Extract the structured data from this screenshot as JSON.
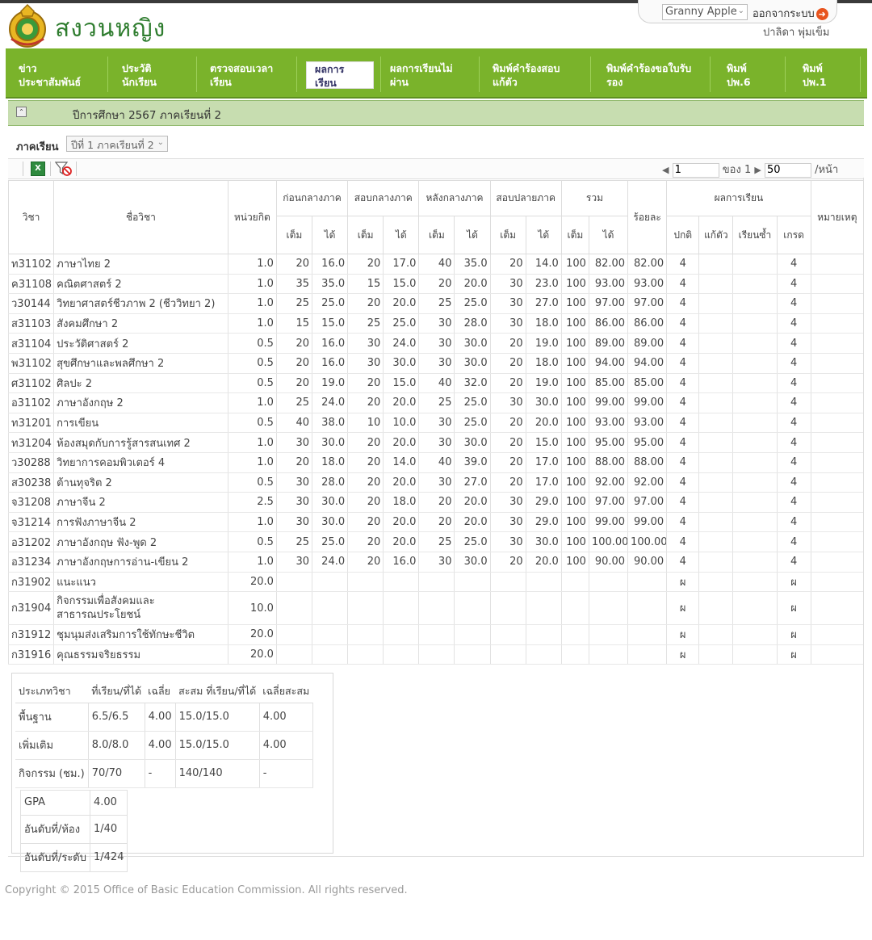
{
  "header": {
    "site_name": "สงวนหญิง",
    "user_select_value": "Granny Apple",
    "logout_label": "ออกจากระบบ",
    "username": "ปาลิดา  พุ่มเข็ม"
  },
  "nav": [
    {
      "line1": "ข่าว",
      "line2": "ประชาสัมพันธ์"
    },
    {
      "line1": "ประวัติ",
      "line2": "นักเรียน"
    },
    {
      "line1": "ตรวจสอบเวลา",
      "line2": "เรียน"
    },
    {
      "line1": "ผลการ",
      "line2": "เรียน"
    },
    {
      "line1": "ผลการเรียนไม่",
      "line2": "ผ่าน"
    },
    {
      "line1": "พิมพ์คำร้องสอบ",
      "line2": "แก้ตัว"
    },
    {
      "line1": "พิมพ์คำร้องขอใบรับ",
      "line2": "รอง"
    },
    {
      "line1": "พิมพ์",
      "line2": "ปพ.6"
    },
    {
      "line1": "พิมพ์",
      "line2": "ปพ.1"
    }
  ],
  "year_header": "ปีการศึกษา  2567  ภาคเรียนที่  2",
  "semester": {
    "label": "ภาคเรียน",
    "value": "ปีที่  1  ภาคเรียนที่  2"
  },
  "pager": {
    "page": "1",
    "of_label": "ของ",
    "total_pages": "1",
    "page_size": "50",
    "per_page_label": "/หน้า"
  },
  "table": {
    "headers": {
      "code": "วิชา",
      "name": "ชื่อวิชา",
      "credit": "หน่วยกิต",
      "before_mid": "ก่อนกลางภาค",
      "mid": "สอบกลางภาค",
      "after_mid": "หลังกลางภาค",
      "final": "สอบปลายภาค",
      "total": "รวม",
      "percent": "ร้อยละ",
      "results": "ผลการเรียน",
      "remarks": "หมายเหตุ",
      "full": "เต็ม",
      "got": "ได้",
      "normal": "ปกติ",
      "retest": "แก้ตัว",
      "repeat": "เรียนซ้ำ",
      "grade": "เกรด"
    },
    "rows": [
      {
        "code": "ท31102",
        "name": "ภาษาไทย  2",
        "credit": "1.0",
        "v": [
          "20",
          "16.0",
          "20",
          "17.0",
          "40",
          "35.0",
          "20",
          "14.0",
          "100",
          "82.00"
        ],
        "percent": "82.00",
        "normal": "4",
        "retest": "",
        "repeat": "",
        "grade": "4"
      },
      {
        "code": "ค31108",
        "name": "คณิตศาสตร์  2",
        "credit": "1.0",
        "v": [
          "35",
          "35.0",
          "15",
          "15.0",
          "20",
          "20.0",
          "30",
          "23.0",
          "100",
          "93.00"
        ],
        "percent": "93.00",
        "normal": "4",
        "retest": "",
        "repeat": "",
        "grade": "4"
      },
      {
        "code": "ว30144",
        "name": "วิทยาศาสตร์ชีวภาพ  2  (ชีววิทยา  2)",
        "credit": "1.0",
        "v": [
          "25",
          "25.0",
          "20",
          "20.0",
          "25",
          "25.0",
          "30",
          "27.0",
          "100",
          "97.00"
        ],
        "percent": "97.00",
        "normal": "4",
        "retest": "",
        "repeat": "",
        "grade": "4"
      },
      {
        "code": "ส31103",
        "name": "สังคมศึกษา  2",
        "credit": "1.0",
        "v": [
          "15",
          "15.0",
          "25",
          "25.0",
          "30",
          "28.0",
          "30",
          "18.0",
          "100",
          "86.00"
        ],
        "percent": "86.00",
        "normal": "4",
        "retest": "",
        "repeat": "",
        "grade": "4"
      },
      {
        "code": "ส31104",
        "name": "ประวัติศาสตร์  2",
        "credit": "0.5",
        "v": [
          "20",
          "16.0",
          "30",
          "24.0",
          "30",
          "30.0",
          "20",
          "19.0",
          "100",
          "89.00"
        ],
        "percent": "89.00",
        "normal": "4",
        "retest": "",
        "repeat": "",
        "grade": "4"
      },
      {
        "code": "พ31102",
        "name": "สุขศึกษาและพลศึกษา  2",
        "credit": "0.5",
        "v": [
          "20",
          "16.0",
          "30",
          "30.0",
          "30",
          "30.0",
          "20",
          "18.0",
          "100",
          "94.00"
        ],
        "percent": "94.00",
        "normal": "4",
        "retest": "",
        "repeat": "",
        "grade": "4"
      },
      {
        "code": "ศ31102",
        "name": "ศิลปะ  2",
        "credit": "0.5",
        "v": [
          "20",
          "19.0",
          "20",
          "15.0",
          "40",
          "32.0",
          "20",
          "19.0",
          "100",
          "85.00"
        ],
        "percent": "85.00",
        "normal": "4",
        "retest": "",
        "repeat": "",
        "grade": "4"
      },
      {
        "code": "อ31102",
        "name": "ภาษาอังกฤษ  2",
        "credit": "1.0",
        "v": [
          "25",
          "24.0",
          "20",
          "20.0",
          "25",
          "25.0",
          "30",
          "30.0",
          "100",
          "99.00"
        ],
        "percent": "99.00",
        "normal": "4",
        "retest": "",
        "repeat": "",
        "grade": "4"
      },
      {
        "code": "ท31201",
        "name": "การเขียน",
        "credit": "0.5",
        "v": [
          "40",
          "38.0",
          "10",
          "10.0",
          "30",
          "25.0",
          "20",
          "20.0",
          "100",
          "93.00"
        ],
        "percent": "93.00",
        "normal": "4",
        "retest": "",
        "repeat": "",
        "grade": "4"
      },
      {
        "code": "ท31204",
        "name": "ห้องสมุดกับการรู้สารสนเทศ  2",
        "credit": "1.0",
        "v": [
          "30",
          "30.0",
          "20",
          "20.0",
          "30",
          "30.0",
          "20",
          "15.0",
          "100",
          "95.00"
        ],
        "percent": "95.00",
        "normal": "4",
        "retest": "",
        "repeat": "",
        "grade": "4"
      },
      {
        "code": "ว30288",
        "name": "วิทยาการคอมพิวเตอร์  4",
        "credit": "1.0",
        "v": [
          "20",
          "18.0",
          "20",
          "14.0",
          "40",
          "39.0",
          "20",
          "17.0",
          "100",
          "88.00"
        ],
        "percent": "88.00",
        "normal": "4",
        "retest": "",
        "repeat": "",
        "grade": "4"
      },
      {
        "code": "ส30238",
        "name": "ต้านทุจริต  2",
        "credit": "0.5",
        "v": [
          "30",
          "28.0",
          "20",
          "20.0",
          "30",
          "27.0",
          "20",
          "17.0",
          "100",
          "92.00"
        ],
        "percent": "92.00",
        "normal": "4",
        "retest": "",
        "repeat": "",
        "grade": "4"
      },
      {
        "code": "จ31208",
        "name": "ภาษาจีน  2",
        "credit": "2.5",
        "v": [
          "30",
          "30.0",
          "20",
          "18.0",
          "20",
          "20.0",
          "30",
          "29.0",
          "100",
          "97.00"
        ],
        "percent": "97.00",
        "normal": "4",
        "retest": "",
        "repeat": "",
        "grade": "4"
      },
      {
        "code": "จ31214",
        "name": "การฟังภาษาจีน  2",
        "credit": "1.0",
        "v": [
          "30",
          "30.0",
          "20",
          "20.0",
          "20",
          "20.0",
          "30",
          "29.0",
          "100",
          "99.00"
        ],
        "percent": "99.00",
        "normal": "4",
        "retest": "",
        "repeat": "",
        "grade": "4"
      },
      {
        "code": "อ31202",
        "name": "ภาษาอังกฤษ  ฟัง-พูด  2",
        "credit": "0.5",
        "v": [
          "25",
          "25.0",
          "20",
          "20.0",
          "25",
          "25.0",
          "30",
          "30.0",
          "100",
          "100.00"
        ],
        "percent": "100.00",
        "normal": "4",
        "retest": "",
        "repeat": "",
        "grade": "4"
      },
      {
        "code": "อ31234",
        "name": "ภาษาอังกฤษการอ่าน-เขียน  2",
        "credit": "1.0",
        "v": [
          "30",
          "24.0",
          "20",
          "16.0",
          "30",
          "30.0",
          "20",
          "20.0",
          "100",
          "90.00"
        ],
        "percent": "90.00",
        "normal": "4",
        "retest": "",
        "repeat": "",
        "grade": "4"
      },
      {
        "code": "ก31902",
        "name": "แนะแนว",
        "credit": "20.0",
        "v": [
          "",
          "",
          "",
          "",
          "",
          "",
          "",
          "",
          "",
          ""
        ],
        "percent": "",
        "normal": "ผ",
        "retest": "",
        "repeat": "",
        "grade": "ผ"
      },
      {
        "code": "ก31904",
        "name": "กิจกรรมเพื่อสังคมและสาธารณประโยชน์",
        "credit": "10.0",
        "v": [
          "",
          "",
          "",
          "",
          "",
          "",
          "",
          "",
          "",
          ""
        ],
        "percent": "",
        "normal": "ผ",
        "retest": "",
        "repeat": "",
        "grade": "ผ",
        "tall": true
      },
      {
        "code": "ก31912",
        "name": "ชุมนุมส่งเสริมการใช้ทักษะชีวิต",
        "credit": "20.0",
        "v": [
          "",
          "",
          "",
          "",
          "",
          "",
          "",
          "",
          "",
          ""
        ],
        "percent": "",
        "normal": "ผ",
        "retest": "",
        "repeat": "",
        "grade": "ผ"
      },
      {
        "code": "ก31916",
        "name": "คุณธรรมจริยธรรม",
        "credit": "20.0",
        "v": [
          "",
          "",
          "",
          "",
          "",
          "",
          "",
          "",
          "",
          ""
        ],
        "percent": "",
        "normal": "ผ",
        "retest": "",
        "repeat": "",
        "grade": "ผ"
      }
    ]
  },
  "summary": {
    "headers": [
      "ประเภทวิชา",
      "ที่เรียน/ที่ได้",
      "เฉลี่ย",
      "สะสม  ที่เรียน/ที่ได้",
      "เฉลี่ยสะสม"
    ],
    "rows": [
      [
        "พื้นฐาน",
        "6.5/6.5",
        "4.00",
        "15.0/15.0",
        "4.00"
      ],
      [
        "เพิ่มเติม",
        "8.0/8.0",
        "4.00",
        "15.0/15.0",
        "4.00"
      ],
      [
        "กิจกรรม  (ชม.)",
        "70/70",
        "-",
        "140/140",
        "-"
      ]
    ],
    "gpa_rows": [
      [
        "GPA",
        "4.00"
      ],
      [
        "อันดับที่/ห้อง",
        "1/40"
      ],
      [
        "อันดับที่/ระดับ",
        "1/424"
      ]
    ]
  },
  "footer": "Copyright © 2015 Office of Basic Education Commission. All rights reserved.",
  "colors": {
    "nav_green": "#7ab32b",
    "site_name_green": "#2f7d2f",
    "year_bar": "#c7ddb0"
  }
}
